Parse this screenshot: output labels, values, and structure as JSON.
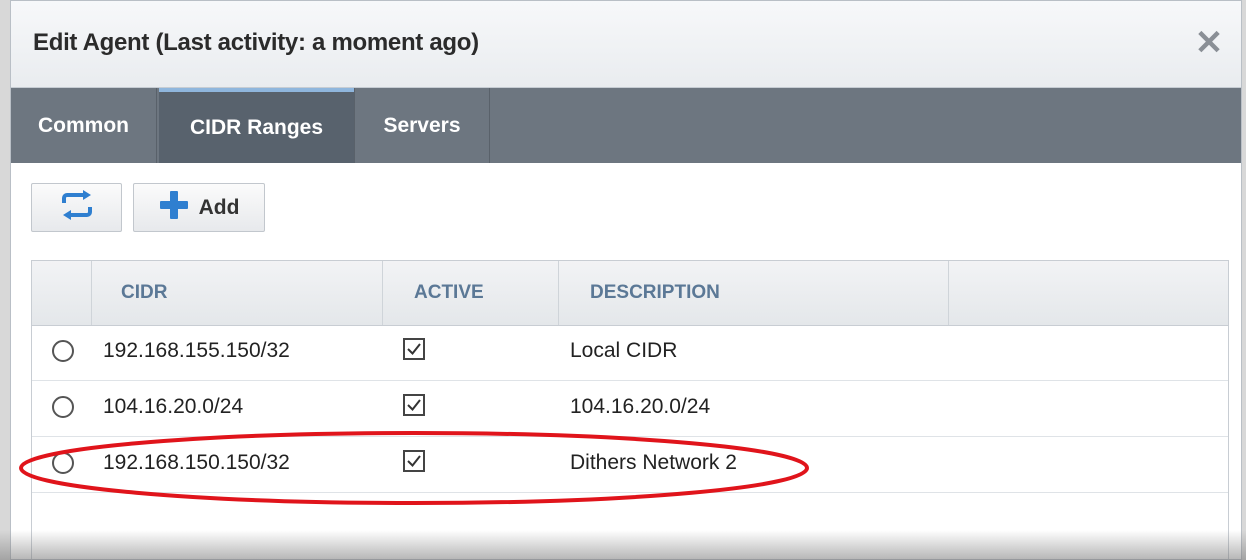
{
  "dialog": {
    "title": "Edit Agent (Last activity: a moment ago)",
    "close_icon": "close-icon"
  },
  "tabs": [
    {
      "label": "Common",
      "active": false
    },
    {
      "label": "CIDR Ranges",
      "active": true
    },
    {
      "label": "Servers",
      "active": false
    }
  ],
  "toolbar": {
    "refresh_icon": "refresh-icon",
    "add_icon": "plus-icon",
    "add_label": "Add"
  },
  "grid": {
    "columns": [
      "CIDR",
      "ACTIVE",
      "DESCRIPTION"
    ],
    "rows": [
      {
        "cidr": "192.168.155.150/32",
        "active": true,
        "description": "Local CIDR"
      },
      {
        "cidr": "104.16.20.0/24",
        "active": true,
        "description": "104.16.20.0/24"
      },
      {
        "cidr": "192.168.150.150/32",
        "active": true,
        "description": "Dithers Network 2",
        "highlighted": true
      }
    ]
  },
  "colors": {
    "tab_bar": "#6d7680",
    "active_tab": "#58626d",
    "header_text": "#5b7896",
    "accent_icon": "#2f7fd0",
    "highlight": "#e0141b"
  }
}
